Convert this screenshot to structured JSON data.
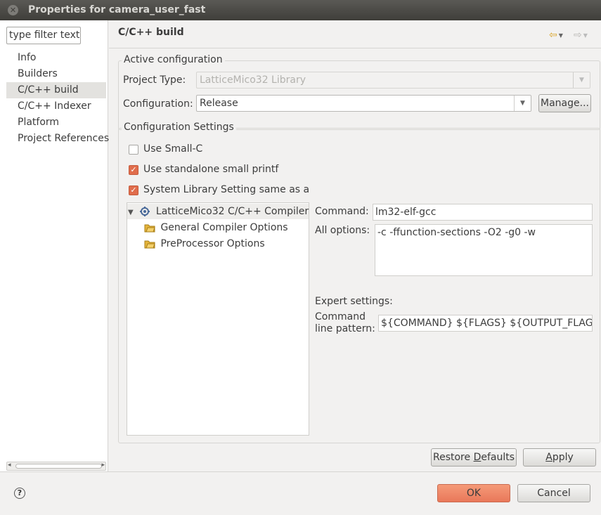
{
  "window": {
    "title": "Properties for camera_user_fast"
  },
  "left": {
    "filter_placeholder": "type filter text",
    "items": [
      "Info",
      "Builders",
      "C/C++ build",
      "C/C++ Indexer",
      "Platform",
      "Project References"
    ]
  },
  "page": {
    "title": "C/C++ build"
  },
  "active": {
    "label": "Active configuration",
    "project_type_label": "Project Type:",
    "project_type_value": "LatticeMico32 Library",
    "configuration_label": "Configuration:",
    "configuration_value": "Release",
    "manage_label": "Manage..."
  },
  "settings": {
    "label": "Configuration Settings",
    "checks": [
      {
        "label": "Use Small-C",
        "checked": false
      },
      {
        "label": "Use standalone small printf",
        "checked": true
      },
      {
        "label": "System Library Setting same as app",
        "checked": true
      }
    ],
    "tree": {
      "root": "LatticeMico32 C/C++ Compiler",
      "children": [
        "General Compiler Options",
        "PreProcessor Options"
      ]
    },
    "command_label": "Command:",
    "command_value": "lm32-elf-gcc",
    "all_options_label": "All options:",
    "all_options_value": "-c -ffunction-sections -O2 -g0 -w",
    "expert_label": "Expert settings:",
    "pattern_label_1": "Command",
    "pattern_label_2": "line pattern:",
    "pattern_value": "${COMMAND} ${FLAGS} ${OUTPUT_FLAG}${OUTPUT_PREFIX}${OUTPUT}"
  },
  "buttons": {
    "restore_pre": "Restore ",
    "restore_u": "D",
    "restore_post": "efaults",
    "apply_u": "A",
    "apply_post": "pply",
    "ok": "OK",
    "cancel": "Cancel"
  },
  "colors": {
    "accent": "#e9785a",
    "check": "#e06d4c",
    "folder": "#e5b53b"
  }
}
